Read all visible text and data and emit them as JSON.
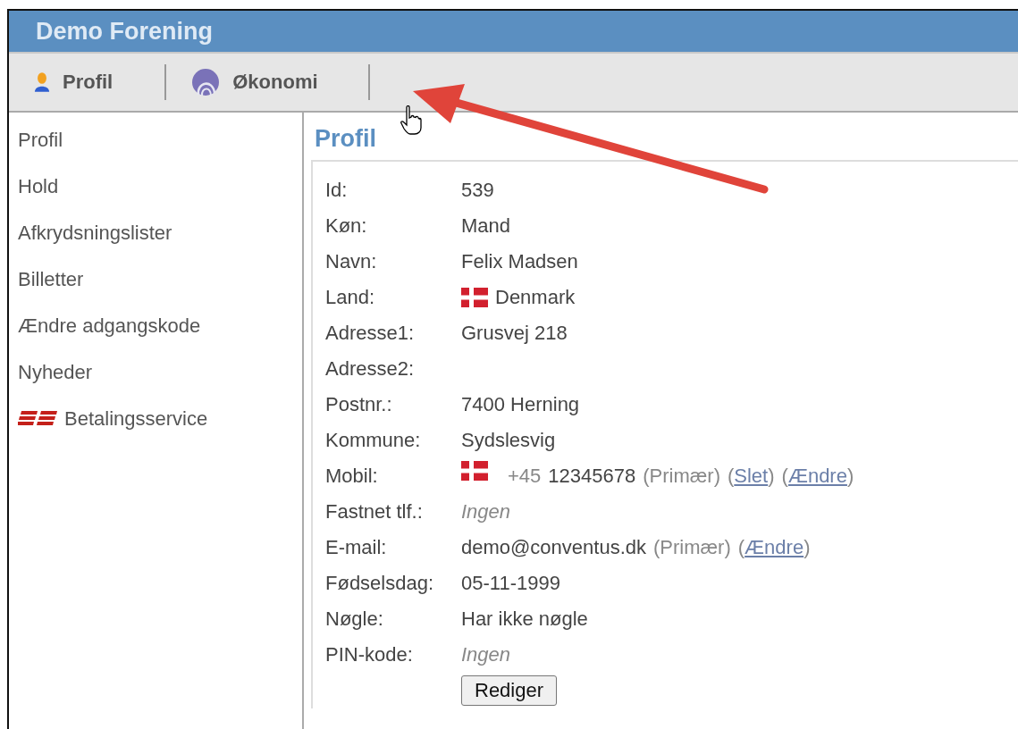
{
  "header": {
    "title": "Demo Forening"
  },
  "tabs": [
    {
      "label": "Profil",
      "selected": false
    },
    {
      "label": "Økonomi",
      "selected": false
    }
  ],
  "sidebar": {
    "items": [
      {
        "label": "Profil"
      },
      {
        "label": "Hold"
      },
      {
        "label": "Afkrydsningslister"
      },
      {
        "label": "Billetter"
      },
      {
        "label": "Ændre adgangskode"
      },
      {
        "label": "Nyheder"
      },
      {
        "label": "Betalingsservice",
        "kind": "logo"
      }
    ]
  },
  "profile": {
    "title": "Profil",
    "rows": [
      {
        "label": "Id:",
        "kind": "text",
        "value": "539"
      },
      {
        "label": "Køn:",
        "kind": "text",
        "value": "Mand"
      },
      {
        "label": "Navn:",
        "kind": "text",
        "value": "Felix Madsen"
      },
      {
        "label": "Land:",
        "kind": "flag",
        "value": "Denmark"
      },
      {
        "label": "Adresse1:",
        "kind": "text",
        "value": "Grusvej 218"
      },
      {
        "label": "Adresse2:",
        "kind": "empty"
      },
      {
        "label": "Postnr.:",
        "kind": "text",
        "value": "7400 Herning"
      },
      {
        "label": "Kommune:",
        "kind": "text",
        "value": "Sydslesvig"
      },
      {
        "label": "Mobil:",
        "kind": "phone",
        "prefix": "+45",
        "value": "12345678",
        "note": "(Primær)",
        "links": [
          {
            "before": "(",
            "text": "Slet",
            "after": ")"
          },
          {
            "before": "(",
            "text": "Ændre",
            "after": ")"
          }
        ]
      },
      {
        "label": "Fastnet tlf.:",
        "kind": "none",
        "value": "Ingen"
      },
      {
        "label": "E-mail:",
        "kind": "email",
        "value": "demo@conventus.dk",
        "note": "(Primær)",
        "links": [
          {
            "before": "(",
            "text": "Ændre",
            "after": ")"
          }
        ]
      },
      {
        "label": "Fødselsdag:",
        "kind": "text",
        "value": "05-11-1999"
      },
      {
        "label": "Nøgle:",
        "kind": "text",
        "value": "Har ikke nøgle"
      },
      {
        "label": "PIN-kode:",
        "kind": "none",
        "value": "Ingen"
      }
    ],
    "button": "Rediger"
  }
}
